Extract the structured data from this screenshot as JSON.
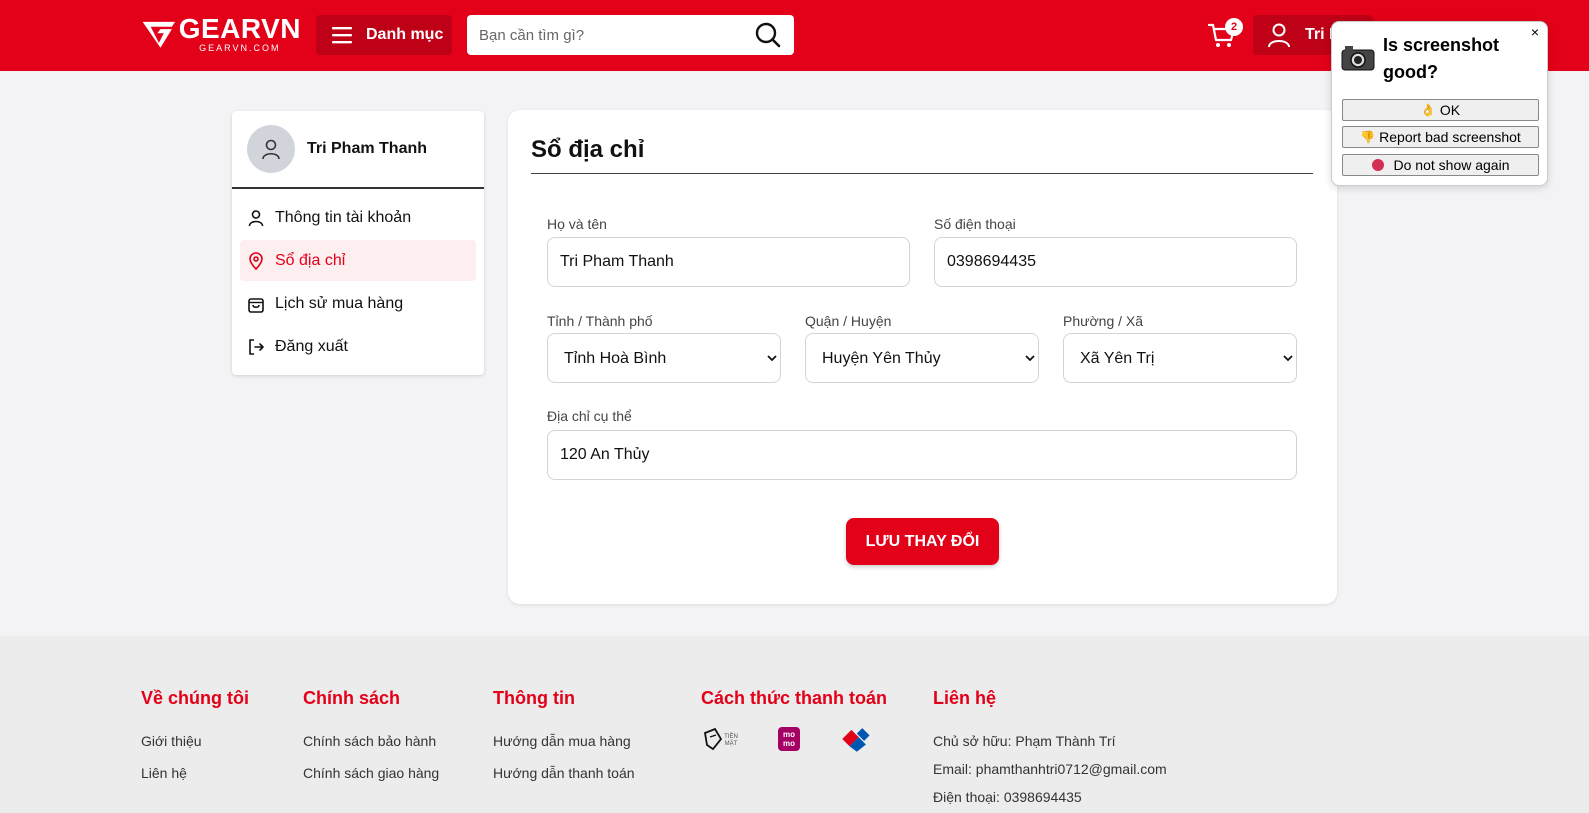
{
  "header": {
    "logo_main": "GEARVN",
    "logo_sub": "GEARVN.COM",
    "menu_label": "Danh mục",
    "search_placeholder": "Bạn cần tìm gì?",
    "cart_count": "2",
    "user_label": "Tri P",
    "brand_color": "#e30019"
  },
  "popup": {
    "close": "×",
    "title": "Is screenshot good?",
    "ok_label": "OK",
    "report_label": "Report bad screenshot",
    "hide_label": "Do not show again"
  },
  "sidebar": {
    "user_name": "Tri Pham Thanh",
    "items": [
      {
        "label": "Thông tin tài khoản",
        "icon": "user-icon"
      },
      {
        "label": "Sổ địa chỉ",
        "icon": "location-icon",
        "active": true
      },
      {
        "label": "Lịch sử mua hàng",
        "icon": "shopping-bag-icon"
      },
      {
        "label": "Đăng xuất",
        "icon": "logout-icon"
      }
    ]
  },
  "address_form": {
    "title": "Sổ địa chỉ",
    "name_label": "Họ và tên",
    "name_value": "Tri Pham Thanh",
    "phone_label": "Số điện thoại",
    "phone_value": "0398694435",
    "province_label": "Tỉnh / Thành phố",
    "province_value": "Tỉnh Hoà Bình",
    "district_label": "Quận / Huyện",
    "district_value": "Huyện Yên Thủy",
    "ward_label": "Phường / Xã",
    "ward_value": "Xã Yên Trị",
    "address_label": "Địa chỉ cụ thể",
    "address_value": "120 An Thủy",
    "save_label": "LƯU THAY ĐỔI"
  },
  "footer": {
    "about": {
      "heading": "Về chúng tôi",
      "links": [
        "Giới thiệu",
        "Liên hệ"
      ]
    },
    "policy": {
      "heading": "Chính sách",
      "links": [
        "Chính sách bảo hành",
        "Chính sách giao hàng"
      ]
    },
    "info": {
      "heading": "Thông tin",
      "links": [
        "Hướng dẫn mua hàng",
        "Hướng dẫn thanh toán"
      ]
    },
    "payment": {
      "heading": "Cách thức thanh toán",
      "cash_label": "TIỀN MẶT",
      "momo_label": "mo mo"
    },
    "contact": {
      "heading": "Liên hệ",
      "owner": "Chủ sở hữu: Phạm Thành Trí",
      "email": "Email: phamthanhtri0712@gmail.com",
      "phone": "Điện thoại: 0398694435"
    }
  }
}
